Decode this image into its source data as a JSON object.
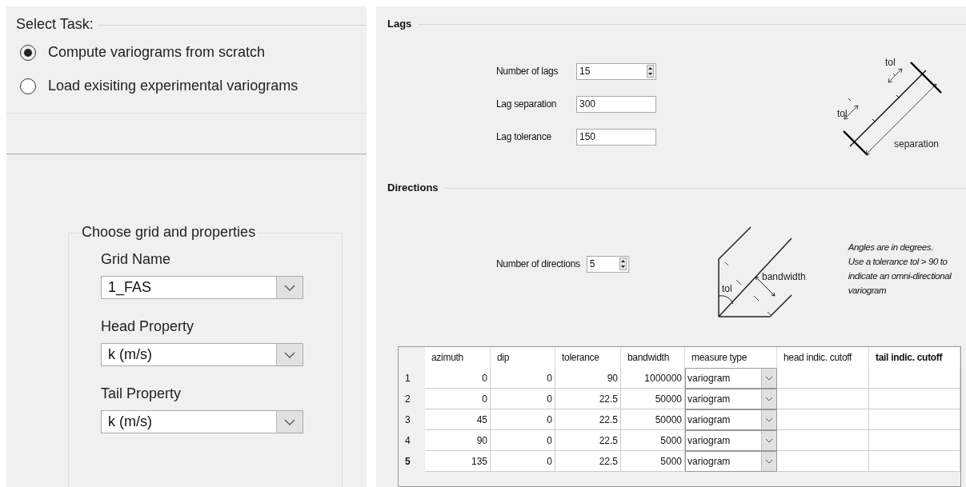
{
  "task": {
    "title": "Select Task:",
    "options": [
      {
        "label": "Compute variograms from scratch",
        "selected": true
      },
      {
        "label": "Load exisiting experimental variograms",
        "selected": false
      }
    ]
  },
  "grid_group": {
    "title": "Choose grid and properties",
    "fields": [
      {
        "label": "Grid Name",
        "value": "1_FAS"
      },
      {
        "label": "Head Property",
        "value": "k (m/s)"
      },
      {
        "label": "Tail Property",
        "value": "k (m/s)"
      }
    ]
  },
  "lags": {
    "title": "Lags",
    "fields": [
      {
        "label": "Number of lags",
        "value": "15",
        "kind": "spinner"
      },
      {
        "label": "Lag separation",
        "value": "300",
        "kind": "text"
      },
      {
        "label": "Lag tolerance",
        "value": "150",
        "kind": "text"
      }
    ],
    "diagram_labels": [
      "tol",
      "tol",
      "separation"
    ]
  },
  "directions": {
    "title": "Directions",
    "number_label": "Number of directions",
    "number_value": "5",
    "diagram_labels": [
      "tol",
      "bandwidth"
    ],
    "note": [
      "Angles are in degrees.",
      "Use a tolerance tol > 90 to",
      "indicate an omni-directional",
      "variogram"
    ]
  },
  "table": {
    "columns": [
      {
        "label": "azimuth",
        "selected": false
      },
      {
        "label": "dip",
        "selected": false
      },
      {
        "label": "tolerance",
        "selected": false
      },
      {
        "label": "bandwidth",
        "selected": false
      },
      {
        "label": "measure type",
        "selected": false
      },
      {
        "label": "head indic. cutoff",
        "selected": false
      },
      {
        "label": "tail indic. cutoff",
        "selected": true
      }
    ],
    "rows": [
      {
        "number": "1",
        "selected": false,
        "cells": [
          "0",
          "0",
          "90",
          "1000000",
          "variogram"
        ]
      },
      {
        "number": "2",
        "selected": false,
        "cells": [
          "0",
          "0",
          "22.5",
          "50000",
          "variogram"
        ]
      },
      {
        "number": "3",
        "selected": false,
        "cells": [
          "45",
          "0",
          "22.5",
          "50000",
          "variogram"
        ]
      },
      {
        "number": "4",
        "selected": false,
        "cells": [
          "90",
          "0",
          "22.5",
          "5000",
          "variogram"
        ]
      },
      {
        "number": "5",
        "selected": true,
        "cells": [
          "135",
          "0",
          "22.5",
          "5000",
          "variogram"
        ]
      }
    ]
  }
}
